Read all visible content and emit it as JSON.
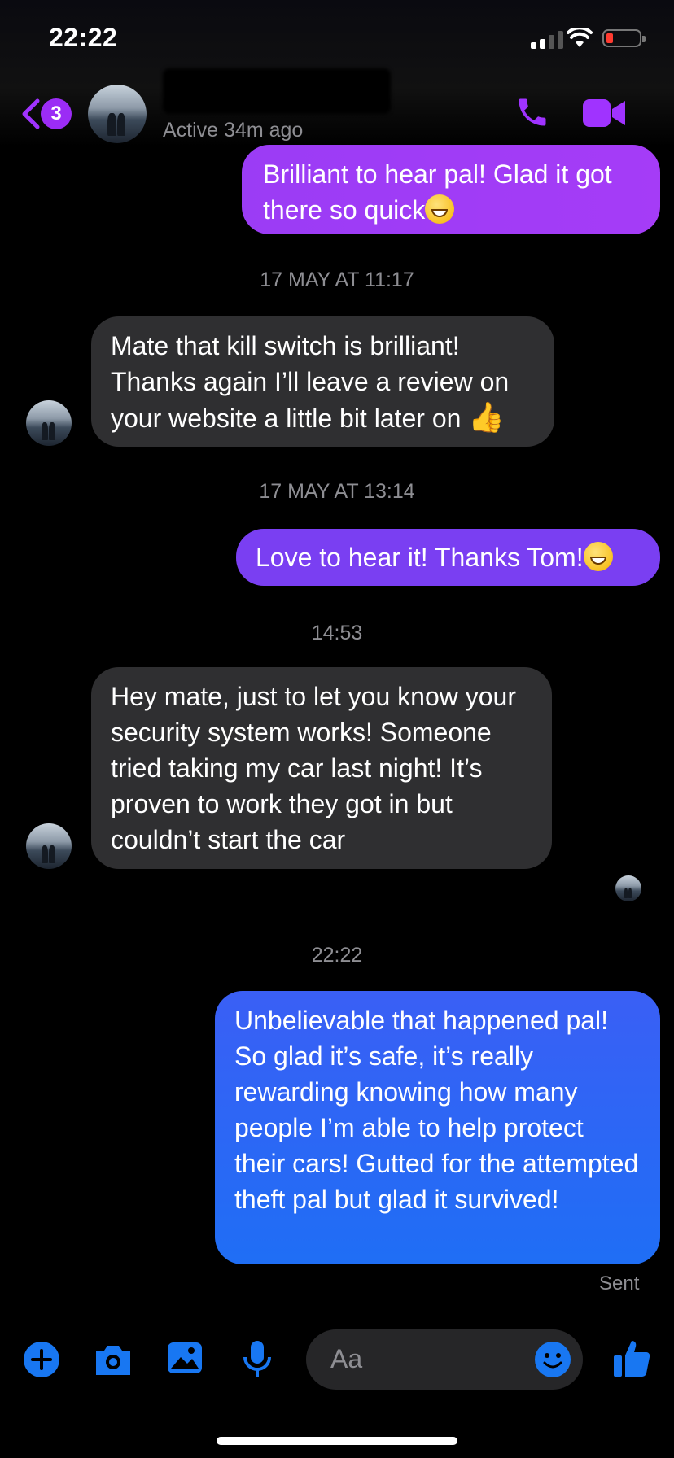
{
  "status_bar": {
    "time": "22:22"
  },
  "header": {
    "unread_count": "3",
    "active_status": "Active 34m ago",
    "icons": [
      "back-chevron-icon",
      "phone-icon",
      "video-camera-icon"
    ],
    "accent_color": "#a033ff"
  },
  "messages": [
    {
      "direction": "outgoing",
      "text": "Brilliant to hear pal! Glad it got there so quick",
      "emoji": "grinning-face"
    },
    {
      "type": "timestamp",
      "text": "17 MAY AT 11:17"
    },
    {
      "direction": "incoming",
      "text": "Mate that kill switch is brilliant! Thanks again I’ll leave a review on your website a little bit later on",
      "emoji": "thumbs-up"
    },
    {
      "type": "timestamp",
      "text": "17 MAY AT 13:14"
    },
    {
      "direction": "outgoing",
      "text": "Love to hear it! Thanks Tom!",
      "emoji": "grinning-face"
    },
    {
      "type": "timestamp",
      "text": "14:53"
    },
    {
      "direction": "incoming",
      "text": "Hey mate, just to let you know your security system works! Someone tried taking my car last night! It’s proven to work they got in but couldn’t start the car"
    },
    {
      "type": "timestamp",
      "text": "22:22"
    },
    {
      "direction": "outgoing",
      "text": "Unbelievable that happened pal! So glad it’s safe, it’s really rewarding knowing how many people I’m able to help protect their cars! Gutted for the attempted theft pal but glad it survived!"
    }
  ],
  "sent_status": "Sent",
  "composer": {
    "placeholder": "Aa",
    "icons": [
      "plus-icon",
      "camera-icon",
      "photo-icon",
      "microphone-icon",
      "emoji-icon",
      "thumbs-up-icon"
    ],
    "icon_color": "#1877f2"
  },
  "colors": {
    "outgoing_purple": "#9b3cf5",
    "outgoing_blue": "#1f6ef5",
    "incoming_bg": "#2f2f31",
    "background": "#000000"
  }
}
